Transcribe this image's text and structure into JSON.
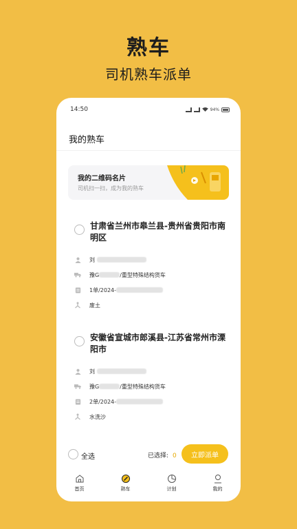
{
  "hero": {
    "title": "熟车",
    "subtitle": "司机熟车派单"
  },
  "status_bar": {
    "time": "14:50",
    "battery": "94%"
  },
  "page": {
    "title": "我的熟车"
  },
  "qr_card": {
    "title": "我的二维码名片",
    "subtitle": "司机扫一扫，成为我的熟车"
  },
  "orders": [
    {
      "route": "甘肃省兰州市皋兰县-贵州省贵阳市南明区",
      "driver_prefix": "刘",
      "vehicle_prefix": "豫G",
      "vehicle_type": "/重型特殊结构货车",
      "trips_prefix": "1单/2024-",
      "cargo": "废土"
    },
    {
      "route": "安徽省宣城市郎溪县-江苏省常州市溧阳市",
      "driver_prefix": "刘",
      "vehicle_prefix": "豫G",
      "vehicle_type": "/重型特殊结构货车",
      "trips_prefix": "2单/2024-",
      "cargo": "水洗沙"
    }
  ],
  "footer": {
    "select_all": "全选",
    "selected_label": "已选择:",
    "selected_count": "0",
    "dispatch_button": "立即派单"
  },
  "tabs": [
    {
      "label": "首页",
      "icon": "home-icon"
    },
    {
      "label": "熟车",
      "icon": "wheel-icon"
    },
    {
      "label": "计划",
      "icon": "plan-icon"
    },
    {
      "label": "我的",
      "icon": "profile-icon"
    }
  ],
  "colors": {
    "background": "#F2BE45",
    "accent": "#F5C01C"
  }
}
